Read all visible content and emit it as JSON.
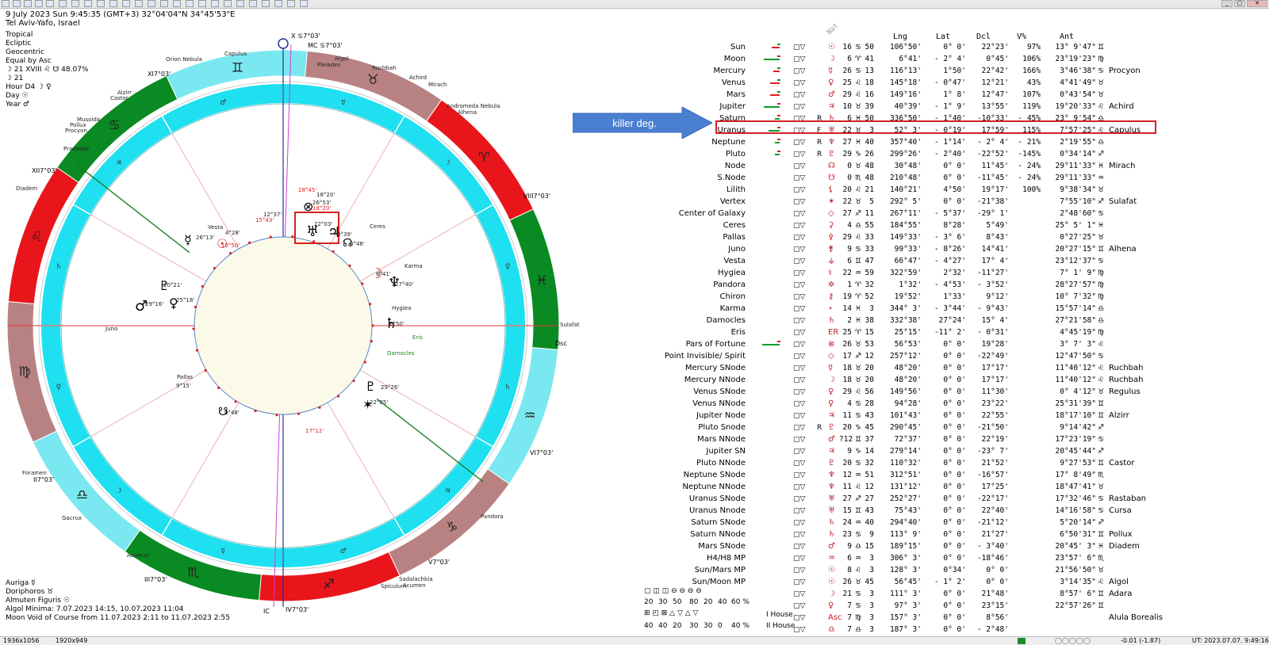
{
  "header": {
    "line1": "9 July 2023  Sun   9:45:35 (GMT+3) 32°04'04\"N  34°45'53\"E",
    "line2": "Tel Aviv-Yafo, Israel"
  },
  "chart_params": [
    "Tropical",
    "Ecliptic",
    "Geocentric",
    "Equal by Asc"
  ],
  "moon_line": "☽  21 XVIII  ♌ ☋ 48.07%",
  "moon_line2": "☽  21",
  "hour": "Hour D4  ☽ ♀",
  "day": "Day  ☉",
  "year": "Year  ♂",
  "bottom_info": [
    "Auriga ☿",
    "Doriphoros ♉",
    "Almuten Figuris ☉",
    "Algol Minima: 7.07.2023 14:15,  10.07.2023 11:04",
    "Moon Void of Course from 11.07.2023  2:11 to 11.07.2023  2:55"
  ],
  "status_left": "1936x1056",
  "status_size": "1920x949",
  "status_coords": "-0.01 (-1.87)",
  "status_ut": "UT: 2023.07.07. 9:49:16",
  "callout": {
    "label": "killer deg.",
    "color": "#4a7fd0"
  },
  "nat_label": "Nat",
  "columns": {
    "lng": "Lng",
    "lat": "Lat",
    "dcl": "Dcl",
    "v": "V%",
    "ant": "Ant"
  },
  "colors": {
    "red_sign": "#e8151a",
    "green_sign": "#0a8a22",
    "brown_sign": "#b88282",
    "cyan_sign": "#7ae8f0",
    "cyan_ring": "#1ee0f0",
    "highlight": "#d62020"
  },
  "wheel": {
    "mc": "MC ♋7°03'",
    "x": "X ♋7°03'",
    "ic": "IC",
    "dsc": "Dsc",
    "houses": [
      "XI",
      "XII",
      "III",
      "II",
      "VIII",
      "VI",
      "V",
      "IV"
    ],
    "stars": [
      "Orion Nebula",
      "Capulus",
      "Algol",
      "Pleiades",
      "Ruchbah",
      "Achird",
      "Mirach",
      "Andromeda Nebula",
      "Alhena",
      "Alzirr",
      "Castor",
      "Musoida",
      "Pollux",
      "Procyon",
      "Praesepe",
      "Diadem",
      "Foramen",
      "Gacrux",
      "Aculeus",
      "Spiculum",
      "Acumen",
      "Sadalachbia",
      "Sulafat",
      "Pandora",
      "Karma",
      "Hygiea",
      "Damocles",
      "Eris",
      "Ceres",
      "Pallas",
      "Juno",
      "Vesta"
    ],
    "planet_labels": [
      "26°13'",
      "4°28'",
      "10°50'",
      "25°18'",
      "29°16'",
      "20°21'",
      "22°03'",
      "0°39'",
      "0°48'",
      "6°41'",
      "27°40'",
      "6°50'",
      "29°26'",
      "22°05'",
      "0°48'",
      "9°15'",
      "17°12'",
      "15°43'",
      "12°37'",
      "28°45'",
      "18°20'",
      "26°53'",
      "18°20'"
    ]
  },
  "rows": [
    {
      "name": "Sun",
      "sym": "☉",
      "r": "",
      "deg": "16",
      "sg": "♋",
      "min": "50",
      "lng": "106°50'",
      "lat": "0° 0'",
      "dcl": "22°23'",
      "v": "97%",
      "ant": "13° 9'47\"",
      "asg": "♊",
      "star": "",
      "bar": [
        10,
        "r"
      ]
    },
    {
      "name": "Moon",
      "sym": "☽",
      "r": "",
      "deg": "6",
      "sg": "♈",
      "min": "41",
      "lng": "6°41'",
      "lat": "- 2° 4'",
      "dcl": "0°45'",
      "v": "106%",
      "ant": "23°19'23\"",
      "asg": "♍",
      "star": "",
      "bar": [
        20,
        "g"
      ]
    },
    {
      "name": "Mercury",
      "sym": "☿",
      "r": "",
      "deg": "26",
      "sg": "♋",
      "min": "13",
      "lng": "116°13'",
      "lat": "1°50'",
      "dcl": "22°42'",
      "v": "166%",
      "ant": "3°46'38\"",
      "asg": "♋",
      "star": "Procyon",
      "bar": [
        8,
        "r"
      ]
    },
    {
      "name": "Venus",
      "sym": "♀",
      "r": "",
      "deg": "25",
      "sg": "♌",
      "min": "18",
      "lng": "145°18'",
      "lat": "- 0°47'",
      "dcl": "12°21'",
      "v": "43%",
      "ant": "4°41'49\"",
      "asg": "♉",
      "star": "",
      "bar": [
        12,
        "r"
      ]
    },
    {
      "name": "Mars",
      "sym": "♂",
      "r": "",
      "deg": "29",
      "sg": "♌",
      "min": "16",
      "lng": "149°16'",
      "lat": "1° 8'",
      "dcl": "12°47'",
      "v": "107%",
      "ant": "0°43'54\"",
      "asg": "♉",
      "star": "",
      "bar": [
        12,
        "r"
      ]
    },
    {
      "name": "Jupiter",
      "sym": "♃",
      "r": "",
      "deg": "10",
      "sg": "♉",
      "min": "39",
      "lng": "40°39'",
      "lat": "- 1° 9'",
      "dcl": "13°55'",
      "v": "119%",
      "ant": "19°20'33\"",
      "asg": "♌",
      "star": "Achird",
      "bar": [
        20,
        "g"
      ]
    },
    {
      "name": "Saturn",
      "sym": "♄",
      "r": "R",
      "deg": "6",
      "sg": "♓",
      "min": "50",
      "lng": "336°50'",
      "lat": "- 1°40'",
      "dcl": "-10°33'",
      "v": "- 45%",
      "ant": "23° 9'54\"",
      "asg": "♎",
      "star": "",
      "bar": [
        6,
        "g"
      ]
    },
    {
      "name": "Uranus",
      "sym": "♅",
      "r": "F",
      "deg": "22",
      "sg": "♉",
      "min": "3",
      "lng": "52° 3'",
      "lat": "- 0°19'",
      "dcl": "17°59'",
      "v": "115%",
      "ant": "7°57'25\"",
      "asg": "♌",
      "star": "Capulus",
      "bar": [
        14,
        "g"
      ],
      "hl": true
    },
    {
      "name": "Neptune",
      "sym": "♆",
      "r": "R",
      "deg": "27",
      "sg": "♓",
      "min": "40",
      "lng": "357°40'",
      "lat": "- 1°14'",
      "dcl": "- 2° 4'",
      "v": "- 21%",
      "ant": "2°19'55\"",
      "asg": "♎",
      "star": "",
      "bar": [
        6,
        "g"
      ]
    },
    {
      "name": "Pluto",
      "sym": "♇",
      "r": "R",
      "deg": "29",
      "sg": "♑",
      "min": "26",
      "lng": "299°26'",
      "lat": "- 2°40'",
      "dcl": "-22°52'",
      "v": "-145%",
      "ant": "0°34'14\"",
      "asg": "♐",
      "star": "",
      "bar": [
        6,
        "g"
      ]
    },
    {
      "name": "Node",
      "sym": "☊",
      "r": "",
      "deg": "0",
      "sg": "♉",
      "min": "48",
      "lng": "30°48'",
      "lat": "0° 0'",
      "dcl": "11°45'",
      "v": "- 24%",
      "ant": "29°11'33\"",
      "asg": "♓",
      "star": "Mirach"
    },
    {
      "name": "S.Node",
      "sym": "☋",
      "r": "",
      "deg": "0",
      "sg": "♏",
      "min": "48",
      "lng": "210°48'",
      "lat": "0° 0'",
      "dcl": "-11°45'",
      "v": "- 24%",
      "ant": "29°11'33\"",
      "asg": "♒",
      "star": ""
    },
    {
      "name": "Lilith",
      "sym": "⚸",
      "r": "",
      "deg": "20",
      "sg": "♌",
      "min": "21",
      "lng": "140°21'",
      "lat": "4°50'",
      "dcl": "19°17'",
      "v": "100%",
      "ant": "9°38'34\"",
      "asg": "♉",
      "star": ""
    },
    {
      "name": "Vertex",
      "sym": "✶",
      "r": "",
      "deg": "22",
      "sg": "♉",
      "min": "5",
      "lng": "292° 5'",
      "lat": "0° 0'",
      "dcl": "-21°38'",
      "v": "",
      "ant": "7°55'10\"",
      "asg": "♐",
      "star": "Sulafat"
    },
    {
      "name": "Center of Galaxy",
      "sym": "◇",
      "r": "",
      "deg": "27",
      "sg": "♐",
      "min": "11",
      "lng": "267°11'",
      "lat": "- 5°37'",
      "dcl": "-29° 1'",
      "v": "",
      "ant": "2°48'60\"",
      "asg": "♋",
      "star": ""
    },
    {
      "name": "Ceres",
      "sym": "⚳",
      "r": "",
      "deg": "4",
      "sg": "♎",
      "min": "55",
      "lng": "184°55'",
      "lat": "8°28'",
      "dcl": "5°49'",
      "v": "",
      "ant": "25° 5' 1\"",
      "asg": "♓",
      "star": ""
    },
    {
      "name": "Pallas",
      "sym": "⚴",
      "r": "",
      "deg": "29",
      "sg": "♌",
      "min": "33",
      "lng": "149°33'",
      "lat": "- 3° 6'",
      "dcl": "8°43'",
      "v": "",
      "ant": "0°27'25\"",
      "asg": "♉",
      "star": ""
    },
    {
      "name": "Juno",
      "sym": "⚵",
      "r": "",
      "deg": "9",
      "sg": "♋",
      "min": "33",
      "lng": "99°33'",
      "lat": "- 8°26'",
      "dcl": "14°41'",
      "v": "",
      "ant": "20°27'15\"",
      "asg": "♊",
      "star": "Alhena"
    },
    {
      "name": "Vesta",
      "sym": "⚶",
      "r": "",
      "deg": "6",
      "sg": "♊",
      "min": "47",
      "lng": "66°47'",
      "lat": "- 4°27'",
      "dcl": "17° 4'",
      "v": "",
      "ant": "23°12'37\"",
      "asg": "♋",
      "star": ""
    },
    {
      "name": "Hygiea",
      "sym": "⚕",
      "r": "",
      "deg": "22",
      "sg": "♒",
      "min": "59",
      "lng": "322°59'",
      "lat": "2°32'",
      "dcl": "-11°27'",
      "v": "",
      "ant": "7° 1' 9\"",
      "asg": "♍",
      "star": ""
    },
    {
      "name": "Pandora",
      "sym": "✲",
      "r": "",
      "deg": "1",
      "sg": "♈",
      "min": "32",
      "lng": "1°32'",
      "lat": "- 4°53'",
      "dcl": "- 3°52'",
      "v": "",
      "ant": "28°27'57\"",
      "asg": "♍",
      "star": ""
    },
    {
      "name": "Chiron",
      "sym": "⚷",
      "r": "",
      "deg": "19",
      "sg": "♈",
      "min": "52",
      "lng": "19°52'",
      "lat": "1°33'",
      "dcl": "9°12'",
      "v": "",
      "ant": "10° 7'32\"",
      "asg": "♍",
      "star": ""
    },
    {
      "name": "Karma",
      "sym": "⋆",
      "r": "",
      "deg": "14",
      "sg": "♓",
      "min": "3",
      "lng": "344° 3'",
      "lat": "- 3°44'",
      "dcl": "- 9°43'",
      "v": "",
      "ant": "15°57'14\"",
      "asg": "♎",
      "star": ""
    },
    {
      "name": "Damocles",
      "sym": "♄",
      "r": "",
      "deg": "2",
      "sg": "♓",
      "min": "38",
      "lng": "332°38'",
      "lat": "27°24'",
      "dcl": "15° 4'",
      "v": "",
      "ant": "27°21'58\"",
      "asg": "♎",
      "star": ""
    },
    {
      "name": "Eris",
      "sym": "ER",
      "r": "",
      "deg": "25",
      "sg": "♈",
      "min": "15",
      "lng": "25°15'",
      "lat": "-11° 2'",
      "dcl": "- 0°31'",
      "v": "",
      "ant": "4°45'19\"",
      "asg": "♍",
      "star": ""
    },
    {
      "name": "Pars of Fortune",
      "sym": "⊗",
      "r": "",
      "deg": "26",
      "sg": "♉",
      "min": "53",
      "lng": "56°53'",
      "lat": "0° 0'",
      "dcl": "19°28'",
      "v": "",
      "ant": "3° 7' 3\"",
      "asg": "♌",
      "star": "",
      "bar": [
        22,
        "g"
      ]
    },
    {
      "name": "Point Invisible/ Spirit",
      "sym": "◇",
      "r": "",
      "deg": "17",
      "sg": "♐",
      "min": "12",
      "lng": "257°12'",
      "lat": "0° 0'",
      "dcl": "-22°49'",
      "v": "",
      "ant": "12°47'50\"",
      "asg": "♋",
      "star": ""
    },
    {
      "name": "Mercury SNode",
      "sym": "☿",
      "r": "",
      "deg": "18",
      "sg": "♉",
      "min": "20",
      "lng": "48°20'",
      "lat": "0° 0'",
      "dcl": "17°17'",
      "v": "",
      "ant": "11°40'12\"",
      "asg": "♌",
      "star": "Ruchbah"
    },
    {
      "name": "Mercury NNode",
      "sym": "☽",
      "r": "",
      "deg": "18",
      "sg": "♉",
      "min": "20",
      "lng": "48°20'",
      "lat": "0° 0'",
      "dcl": "17°17'",
      "v": "",
      "ant": "11°40'12\"",
      "asg": "♌",
      "star": "Ruchbah"
    },
    {
      "name": "Venus SNode",
      "sym": "♀",
      "r": "",
      "deg": "29",
      "sg": "♌",
      "min": "56",
      "lng": "149°56'",
      "lat": "0° 0'",
      "dcl": "11°30'",
      "v": "",
      "ant": "0° 4'12\"",
      "asg": "♉",
      "star": "Regulus"
    },
    {
      "name": "Venus NNode",
      "sym": "♀",
      "r": "",
      "deg": "4",
      "sg": "♋",
      "min": "28",
      "lng": "94°28'",
      "lat": "0° 0'",
      "dcl": "23°22'",
      "v": "",
      "ant": "25°31'39\"",
      "asg": "♊",
      "star": ""
    },
    {
      "name": "Jupiter Node",
      "sym": "♃",
      "r": "",
      "deg": "11",
      "sg": "♋",
      "min": "43",
      "lng": "101°43'",
      "lat": "0° 0'",
      "dcl": "22°55'",
      "v": "",
      "ant": "18°17'10\"",
      "asg": "♊",
      "star": "Alzirr"
    },
    {
      "name": "Pluto Snode",
      "sym": "♇",
      "r": "R",
      "deg": "20",
      "sg": "♑",
      "min": "45",
      "lng": "290°45'",
      "lat": "0° 0'",
      "dcl": "-21°50'",
      "v": "",
      "ant": "9°14'42\"",
      "asg": "♐",
      "star": ""
    },
    {
      "name": "Mars NNode",
      "sym": "♂",
      "r": "",
      "deg": "?12",
      "sg": "♊",
      "min": "37",
      "lng": "72°37'",
      "lat": "0° 0'",
      "dcl": "22°19'",
      "v": "",
      "ant": "17°23'19\"",
      "asg": "♋",
      "star": ""
    },
    {
      "name": "Jupiter SN",
      "sym": "♃",
      "r": "",
      "deg": "9",
      "sg": "♑",
      "min": "14",
      "lng": "279°14'",
      "lat": "0° 0'",
      "dcl": "-23° 7'",
      "v": "",
      "ant": "20°45'44\"",
      "asg": "♐",
      "star": ""
    },
    {
      "name": "Pluto NNode",
      "sym": "♇",
      "r": "",
      "deg": "20",
      "sg": "♋",
      "min": "32",
      "lng": "110°32'",
      "lat": "0° 0'",
      "dcl": "21°52'",
      "v": "",
      "ant": "9°27'53\"",
      "asg": "♊",
      "star": "Castor"
    },
    {
      "name": "Neptune SNode",
      "sym": "♆",
      "r": "",
      "deg": "12",
      "sg": "♒",
      "min": "51",
      "lng": "312°51'",
      "lat": "0° 0'",
      "dcl": "-16°57'",
      "v": "",
      "ant": "17° 8'49\"",
      "asg": "♏",
      "star": ""
    },
    {
      "name": "Neptune NNode",
      "sym": "♆",
      "r": "",
      "deg": "11",
      "sg": "♌",
      "min": "12",
      "lng": "131°12'",
      "lat": "0° 0'",
      "dcl": "17°25'",
      "v": "",
      "ant": "18°47'41\"",
      "asg": "♉",
      "star": ""
    },
    {
      "name": "Uranus SNode",
      "sym": "♅",
      "r": "",
      "deg": "27",
      "sg": "♐",
      "min": "27",
      "lng": "252°27'",
      "lat": "0° 0'",
      "dcl": "-22°17'",
      "v": "",
      "ant": "17°32'46\"",
      "asg": "♋",
      "star": "Rastaban"
    },
    {
      "name": "Uranus Nnode",
      "sym": "♅",
      "r": "",
      "deg": "15",
      "sg": "♊",
      "min": "43",
      "lng": "75°43'",
      "lat": "0° 0'",
      "dcl": "22°40'",
      "v": "",
      "ant": "14°16'58\"",
      "asg": "♋",
      "star": "Cursa"
    },
    {
      "name": "Saturn SNode",
      "sym": "♄",
      "r": "",
      "deg": "24",
      "sg": "♒",
      "min": "40",
      "lng": "294°40'",
      "lat": "0° 0'",
      "dcl": "-21°12'",
      "v": "",
      "ant": "5°20'14\"",
      "asg": "♐",
      "star": ""
    },
    {
      "name": "Saturn NNode",
      "sym": "♄",
      "r": "",
      "deg": "23",
      "sg": "♋",
      "min": "9",
      "lng": "113° 9'",
      "lat": "0° 0'",
      "dcl": "21°27'",
      "v": "",
      "ant": "6°50'31\"",
      "asg": "♊",
      "star": "Pollux"
    },
    {
      "name": "Mars SNode",
      "sym": "♂",
      "r": "",
      "deg": "9",
      "sg": "♎",
      "min": "15",
      "lng": "189°15'",
      "lat": "0° 0'",
      "dcl": "- 3°40'",
      "v": "",
      "ant": "20°45' 3\"",
      "asg": "♓",
      "star": "Diadem"
    },
    {
      "name": "H4/H8 MP",
      "sym": "♒",
      "r": "",
      "deg": "6",
      "sg": "♒",
      "min": "3",
      "lng": "306° 3'",
      "lat": "0° 0'",
      "dcl": "-18°46'",
      "v": "",
      "ant": "23°57' 6\"",
      "asg": "♏",
      "star": ""
    },
    {
      "name": "Sun/Mars MP",
      "sym": "☉",
      "r": "",
      "deg": "8",
      "sg": "♌",
      "min": "3",
      "lng": "128° 3'",
      "lat": "0°34'",
      "dcl": "0° 0'",
      "v": "",
      "ant": "21°56'50\"",
      "asg": "♉",
      "star": ""
    },
    {
      "name": "Sun/Moon MP",
      "sym": "☉",
      "r": "",
      "deg": "26",
      "sg": "♉",
      "min": "45",
      "lng": "56°45'",
      "lat": "- 1° 2'",
      "dcl": "0° 0'",
      "v": "",
      "ant": "3°14'35\"",
      "asg": "♌",
      "star": "Algol"
    },
    {
      "name": "",
      "sym": "☽",
      "r": "",
      "deg": "21",
      "sg": "♋",
      "min": "3",
      "lng": "111° 3'",
      "lat": "0° 0'",
      "dcl": "21°48'",
      "v": "",
      "ant": "8°57' 6\"",
      "asg": "♊",
      "star": "Adara"
    },
    {
      "name": "",
      "sym": "♀",
      "r": "",
      "deg": "7",
      "sg": "♋",
      "min": "3",
      "lng": "97° 3'",
      "lat": "0° 0'",
      "dcl": "23°15'",
      "v": "",
      "ant": "22°57'26\"",
      "asg": "♊",
      "star": ""
    },
    {
      "name": "",
      "sym": "Asc",
      "r": "",
      "deg": "7",
      "sg": "♍",
      "min": "3",
      "lng": "157° 3'",
      "lat": "0° 0'",
      "dcl": "8°56'",
      "v": "",
      "ant": "",
      "asg": "",
      "star": "Alula Borealis"
    },
    {
      "name": "",
      "sym": "♎",
      "r": "",
      "deg": "7",
      "sg": "♎",
      "min": "3",
      "lng": "187° 3'",
      "lat": "0° 0'",
      "dcl": "- 2°48'",
      "v": "",
      "ant": "",
      "asg": "",
      "star": ""
    }
  ],
  "legend": {
    "row1": [
      "20",
      "30",
      "50",
      "80",
      "20",
      "40",
      "60 %"
    ],
    "row2": [
      "40",
      "40",
      "20",
      "30",
      "30",
      "0",
      "40 %"
    ],
    "house_i": "I House",
    "house_ii": "II House"
  }
}
